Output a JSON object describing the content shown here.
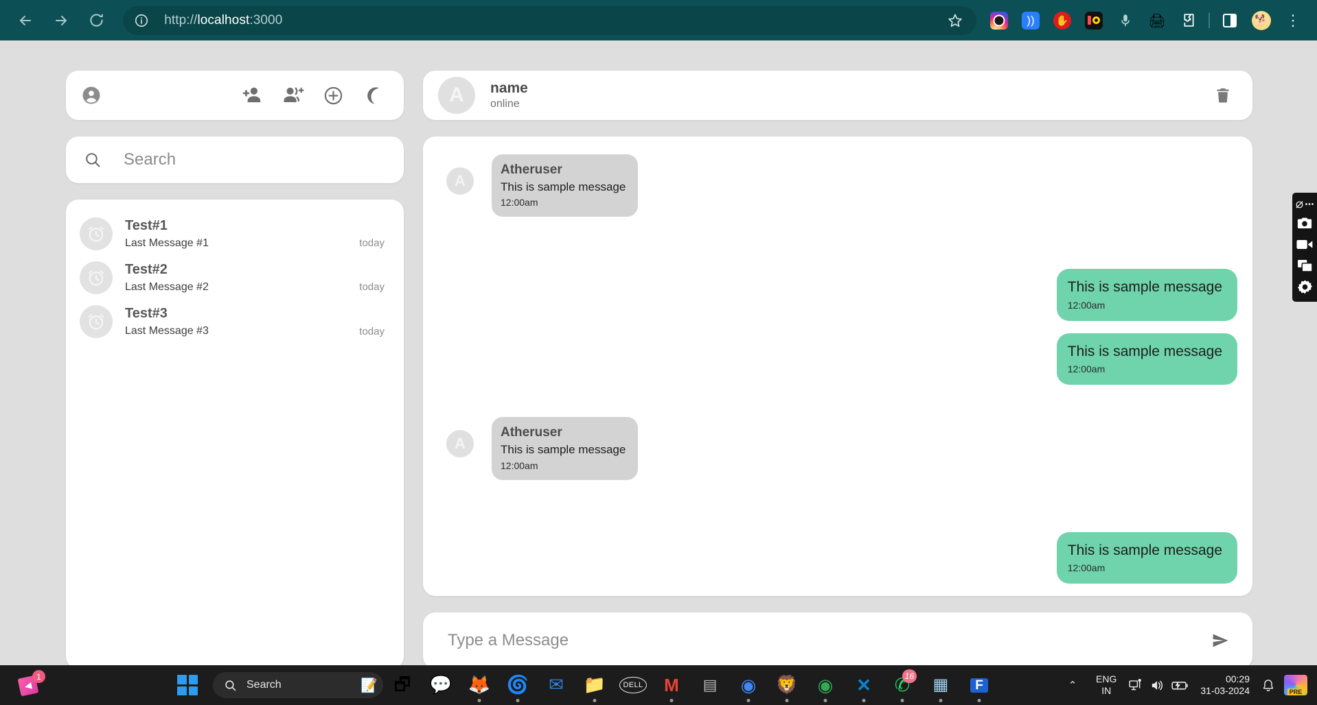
{
  "browser": {
    "url_scheme": "http://",
    "url_host": "localhost",
    "url_port": ":3000",
    "url_full": "http://localhost:3000",
    "back_label": "Back",
    "forward_label": "Forward",
    "reload_label": "Reload",
    "site_info_label": "View site information",
    "bookmark_label": "Bookmark this tab",
    "menu_label": "Customize and control",
    "extensions": [
      {
        "name": "instagram-extension-icon",
        "glyph": ""
      },
      {
        "name": "cast-receiver-icon",
        "glyph": "))"
      },
      {
        "name": "adblock-stop-icon",
        "glyph": "✋"
      },
      {
        "name": "recorder-extension-icon",
        "glyph": ""
      },
      {
        "name": "microphone-icon",
        "glyph": ""
      },
      {
        "name": "screen-capture-icon",
        "glyph": "🖨"
      },
      {
        "name": "extensions-puzzle-icon",
        "glyph": ""
      },
      {
        "name": "side-panel-icon",
        "glyph": ""
      },
      {
        "name": "profile-avatar-icon",
        "glyph": "🐕"
      }
    ]
  },
  "sidebar": {
    "profile_icon": "account-circle-icon",
    "header_actions": [
      {
        "name": "add-contact-icon",
        "label": "Add contact"
      },
      {
        "name": "create-group-icon",
        "label": "Create group"
      },
      {
        "name": "add-circle-icon",
        "label": "New chat"
      },
      {
        "name": "dark-mode-moon-icon",
        "label": "Toggle dark mode"
      }
    ],
    "search": {
      "placeholder": "Search",
      "value": "",
      "icon": "search-icon"
    },
    "chats": [
      {
        "avatar_icon": "alarm-clock-icon",
        "name": "Test#1",
        "last_message": "Last Message #1",
        "time": "today"
      },
      {
        "avatar_icon": "alarm-clock-icon",
        "name": "Test#2",
        "last_message": "Last Message #2",
        "time": "today"
      },
      {
        "avatar_icon": "alarm-clock-icon",
        "name": "Test#3",
        "last_message": "Last Message #3",
        "time": "today"
      }
    ]
  },
  "conversation": {
    "header": {
      "avatar_initial": "A",
      "name": "name",
      "status": "online",
      "delete_icon": "trash-icon",
      "delete_label": "Delete chat"
    },
    "messages": [
      {
        "direction": "in",
        "avatar_initial": "A",
        "sender": "Atheruser",
        "text": "This is sample message",
        "time": "12:00am"
      },
      {
        "direction": "out",
        "sender": "",
        "text": "This is sample message",
        "time": "12:00am"
      },
      {
        "direction": "out",
        "sender": "",
        "text": "This is sample message",
        "time": "12:00am"
      },
      {
        "direction": "in",
        "avatar_initial": "A",
        "sender": "Atheruser",
        "text": "This is sample message",
        "time": "12:00am"
      },
      {
        "direction": "out",
        "sender": "",
        "text": "This is sample message",
        "time": "12:00am"
      }
    ],
    "compose": {
      "placeholder": "Type a Message",
      "value": "",
      "send_icon": "send-icon",
      "send_label": "Send"
    }
  },
  "colors": {
    "browser_chrome": "#0c5055",
    "outgoing_bubble": "#6fd3ab",
    "incoming_bubble": "#d3d3d3",
    "page_background": "#dedede",
    "panel": "#ffffff",
    "taskbar": "#1c1c1c"
  },
  "recorder_widget": {
    "items": [
      {
        "name": "recorder-drag-icon",
        "label": "Recorder options"
      },
      {
        "name": "screenshot-camera-icon",
        "label": "Take screenshot"
      },
      {
        "name": "video-camera-icon",
        "label": "Record video"
      },
      {
        "name": "window-capture-icon",
        "label": "Capture window"
      },
      {
        "name": "settings-gear-icon",
        "label": "Settings"
      }
    ]
  },
  "taskbar": {
    "notification_badge": "1",
    "start_label": "Start",
    "search": {
      "placeholder": "Search",
      "value": ""
    },
    "apps": [
      {
        "name": "taskview-icon",
        "glyph": "🗗",
        "running": false,
        "badge": ""
      },
      {
        "name": "teams-icon",
        "glyph": "💬",
        "running": false,
        "badge": ""
      },
      {
        "name": "firefox-icon",
        "glyph": "🦊",
        "running": true,
        "badge": ""
      },
      {
        "name": "edge-icon",
        "glyph": "🌀",
        "running": true,
        "badge": ""
      },
      {
        "name": "mail-icon",
        "glyph": "✉",
        "running": false,
        "badge": ""
      },
      {
        "name": "file-explorer-icon",
        "glyph": "📁",
        "running": true,
        "badge": ""
      },
      {
        "name": "dell-support-icon",
        "glyph": "DELL",
        "running": false,
        "badge": ""
      },
      {
        "name": "gmail-icon",
        "glyph": "M",
        "running": true,
        "badge": ""
      },
      {
        "name": "phone-link-icon",
        "glyph": "▤",
        "running": false,
        "badge": ""
      },
      {
        "name": "chrome-profile-1-icon",
        "glyph": "◉",
        "running": true,
        "badge": ""
      },
      {
        "name": "brave-icon",
        "glyph": "🦁",
        "running": true,
        "badge": ""
      },
      {
        "name": "chrome-profile-2-icon",
        "glyph": "◉",
        "running": true,
        "badge": ""
      },
      {
        "name": "vscode-icon",
        "glyph": "✕",
        "running": true,
        "badge": ""
      },
      {
        "name": "whatsapp-icon",
        "glyph": "✆",
        "running": true,
        "badge": "16"
      },
      {
        "name": "calculator-icon",
        "glyph": "▦",
        "running": true,
        "badge": ""
      },
      {
        "name": "figma-icon",
        "glyph": "F",
        "running": true,
        "badge": ""
      }
    ],
    "tray": {
      "chevron": "⌃",
      "language_line1": "ENG",
      "language_line2": "IN",
      "network_icon": "network-icon",
      "volume_icon": "volume-icon",
      "battery_icon": "battery-charging-icon",
      "time": "00:29",
      "date": "31-03-2024",
      "bell_icon": "notification-bell-icon",
      "copilot_label": "PRE"
    }
  }
}
